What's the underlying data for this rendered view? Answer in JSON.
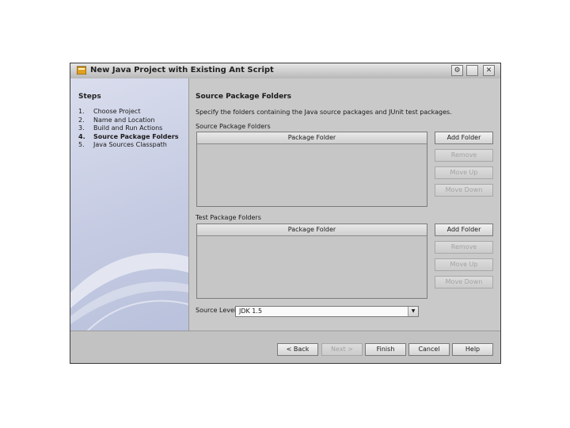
{
  "window": {
    "title": "New Java Project with Existing Ant Script"
  },
  "steps": {
    "heading": "Steps",
    "items": [
      {
        "num": "1.",
        "label": "Choose Project"
      },
      {
        "num": "2.",
        "label": "Name and Location"
      },
      {
        "num": "3.",
        "label": "Build and Run Actions"
      },
      {
        "num": "4.",
        "label": "Source Package Folders"
      },
      {
        "num": "5.",
        "label": "Java Sources Classpath"
      }
    ],
    "current_index": 4
  },
  "panel": {
    "title": "Source Package Folders",
    "instructions": "Specify the folders containing the Java source packages and JUnit test packages.",
    "source_section": {
      "label": "Source Package Folders",
      "column_header": "Package Folder",
      "buttons": {
        "add": "Add Folder",
        "remove": "Remove",
        "move_up": "Move Up",
        "move_down": "Move Down"
      }
    },
    "test_section": {
      "label": "Test Package Folders",
      "column_header": "Package Folder",
      "buttons": {
        "add": "Add Folder",
        "remove": "Remove",
        "move_up": "Move Up",
        "move_down": "Move Down"
      }
    },
    "source_level": {
      "label": "Source Level:",
      "value": "JDK 1.5"
    }
  },
  "footer": {
    "back": "< Back",
    "next": "Next >",
    "finish": "Finish",
    "cancel": "Cancel",
    "help": "Help"
  },
  "icons": {
    "app": "java-project-icon",
    "title_buttons": [
      "settings-icon",
      "minimize-icon",
      "close-icon"
    ]
  }
}
